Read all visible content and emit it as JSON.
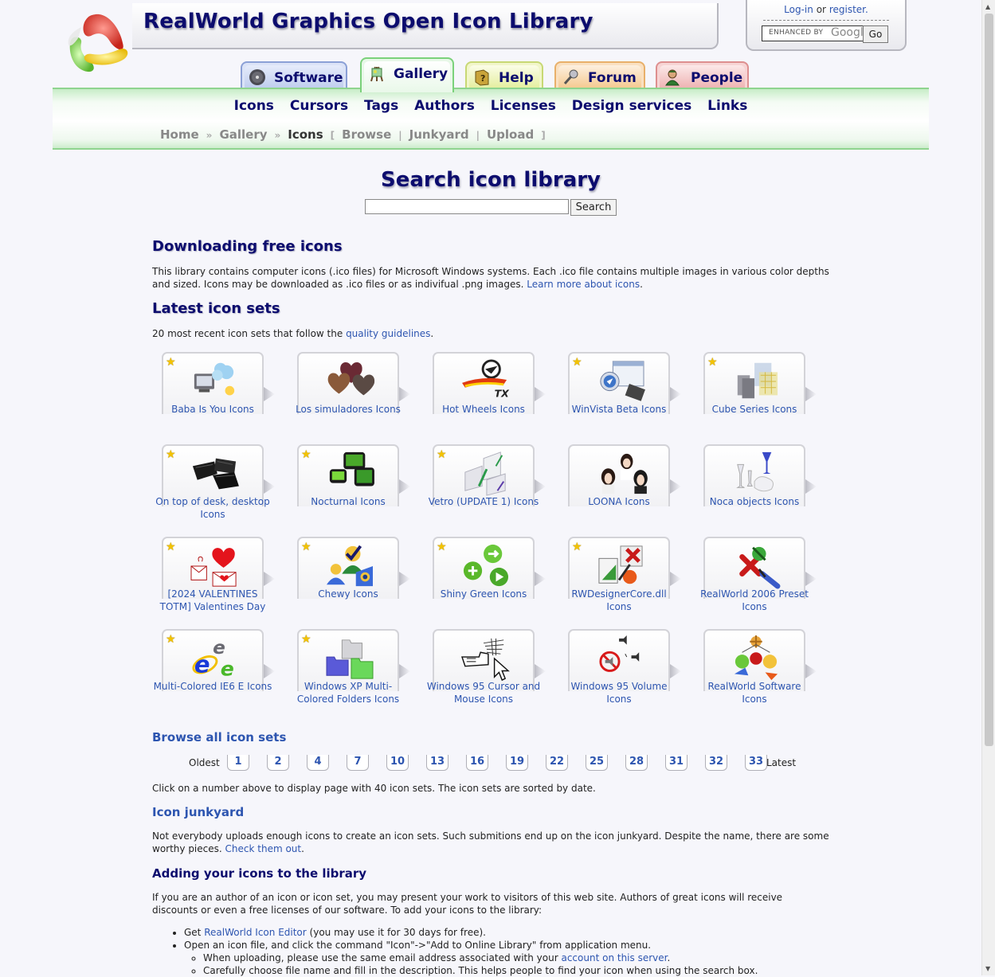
{
  "site": {
    "title": "RealWorld Graphics Open Icon Library"
  },
  "login": {
    "login_label": "Log-in",
    "or_text": "or",
    "register_label": "register.",
    "search_hint": "ENHANCED BY",
    "search_brand": "Googl",
    "go_label": "Go"
  },
  "tabs": [
    {
      "label": "Software",
      "icon": "disc-icon"
    },
    {
      "label": "Gallery",
      "icon": "easel-icon"
    },
    {
      "label": "Help",
      "icon": "help-book-icon"
    },
    {
      "label": "Forum",
      "icon": "microphone-icon"
    },
    {
      "label": "People",
      "icon": "person-icon"
    }
  ],
  "main_nav": [
    "Icons",
    "Cursors",
    "Tags",
    "Authors",
    "Licenses",
    "Design services",
    "Links"
  ],
  "breadcrumb": {
    "home": "Home",
    "gallery": "Gallery",
    "icons": "Icons",
    "browse": "Browse",
    "junkyard": "Junkyard",
    "upload": "Upload"
  },
  "search": {
    "title": "Search icon library",
    "button": "Search",
    "value": ""
  },
  "downloading": {
    "heading": "Downloading free icons",
    "text": "This library contains computer icons (.ico files) for Microsoft Windows systems. Each .ico file contains multiple images in various color depths and sized. Icons may be downloaded as .ico files or as indivifual .png images.",
    "link": "Learn more about icons"
  },
  "latest": {
    "heading": "Latest icon sets",
    "intro": "20 most recent icon sets that follow the",
    "intro_link": "quality guidelines"
  },
  "icon_sets": [
    {
      "name": "Baba Is You Icons",
      "star": true,
      "icon": "monitor-cloud-icon"
    },
    {
      "name": "Los simuladores Icons",
      "star": false,
      "icon": "hearts-portraits-icon"
    },
    {
      "name": "Hot Wheels Icons",
      "star": false,
      "icon": "hot-wheels-logo-icon"
    },
    {
      "name": "WinVista Beta Icons",
      "star": true,
      "icon": "vista-window-icon"
    },
    {
      "name": "Cube Series Icons",
      "star": true,
      "icon": "cube-grid-icon"
    },
    {
      "name": "On top of desk, desktop Icons",
      "star": true,
      "icon": "desk-trays-icon"
    },
    {
      "name": "Nocturnal Icons",
      "star": true,
      "icon": "green-monitors-icon"
    },
    {
      "name": "Vetro (UPDATE 1) Icons",
      "star": true,
      "icon": "glass-panes-icon"
    },
    {
      "name": "LOONA Icons",
      "star": false,
      "icon": "portraits-icon"
    },
    {
      "name": "Noca objects Icons",
      "star": false,
      "icon": "glassware-icon"
    },
    {
      "name": "[2024 VALENTINES TOTM] Valentines Day",
      "star": true,
      "icon": "valentine-icon"
    },
    {
      "name": "Chewy Icons",
      "star": true,
      "icon": "chewy-users-icon"
    },
    {
      "name": "Shiny Green Icons",
      "star": true,
      "icon": "green-buttons-icon"
    },
    {
      "name": "RWDesignerCore.dll Icons",
      "star": true,
      "icon": "designer-tools-icon"
    },
    {
      "name": "RealWorld 2006 Preset Icons",
      "star": false,
      "icon": "preset-tools-icon"
    },
    {
      "name": "Multi-Colored IE6 E Icons",
      "star": true,
      "icon": "ie-logo-icon"
    },
    {
      "name": "Windows XP Multi-Colored Folders Icons",
      "star": true,
      "icon": "folders-icon"
    },
    {
      "name": "Windows 95 Cursor and Mouse Icons",
      "star": false,
      "icon": "cursor-hand-icon"
    },
    {
      "name": "Windows 95 Volume Icons",
      "star": false,
      "icon": "volume-icon"
    },
    {
      "name": "RealWorld Software Icons",
      "star": false,
      "icon": "software-logos-icon"
    }
  ],
  "browse": {
    "heading": "Browse all icon sets",
    "oldest": "Oldest",
    "latest": "Latest",
    "pages": [
      "1",
      "2",
      "4",
      "7",
      "10",
      "13",
      "16",
      "19",
      "22",
      "25",
      "28",
      "31",
      "32",
      "33"
    ],
    "note": "Click on a number above to display page with 40 icon sets. The icon sets are sorted by date."
  },
  "junkyard": {
    "heading": "Icon junkyard",
    "text": "Not everybody uploads enough icons to create an icon sets. Such submitions end up on the icon junkyard. Despite the name, there are some worthy pieces.",
    "link": "Check them out"
  },
  "adding": {
    "heading": "Adding your icons to the library",
    "text": "If you are an author of an icon or icon set, you may present your work to visitors of this web site. Authors of great icons will receive discounts or even a free licenses of our software. To add your icons to the library:",
    "step1_pre": "Get",
    "step1_link": "RealWorld Icon Editor",
    "step1_post": "(you may use it for 30 days for free).",
    "step2": "Open an icon file, and click the command \"Icon\"->\"Add to Online Library\" from application menu.",
    "sub1_pre": "When uploading, please use the same email address associated with your",
    "sub1_link": "account on this server",
    "sub2": "Carefully choose file name and fill in the description. This helps people to find your icon when using the search box."
  },
  "colors": {
    "heading": "#0c0c6e",
    "link": "#2d55b0",
    "nav_green": "#8fd48f",
    "star": "#f3c300"
  }
}
